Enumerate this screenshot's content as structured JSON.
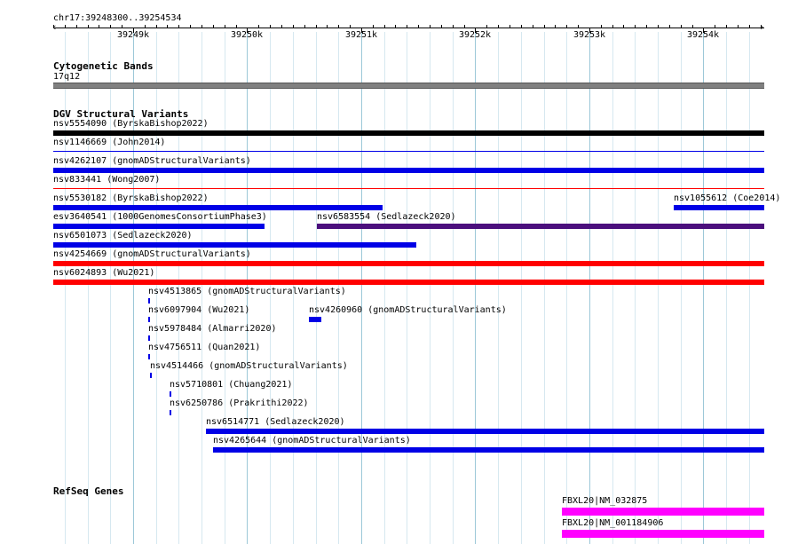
{
  "location": "chr17:39248300..39254534",
  "ruler": {
    "start": 39248300,
    "end": 39254534,
    "ticks": [
      "39249k",
      "39250k",
      "39251k",
      "39252k",
      "39253k",
      "39254k"
    ]
  },
  "colors": {
    "grid_major": "#9cc8d8",
    "grid_minor": "#d6e8f0",
    "separator": "#c83c3c",
    "band": "#808080",
    "black": "#000000",
    "blue": "#0000e6",
    "red": "#ff0000",
    "purple": "#4b0f7d",
    "magenta": "#ff00ff"
  },
  "tracks": {
    "cyto": {
      "title": "Cytogenetic Bands",
      "band_label": "17q12"
    },
    "dgv": {
      "title": "DGV Structural Variants"
    },
    "refseq": {
      "title": "RefSeq Genes"
    }
  },
  "dgv_features": [
    {
      "label": "nsv5554090 (ByrskaBishop2022)",
      "start": 39248300,
      "end": 39254534,
      "color": "black"
    },
    {
      "label": "nsv1146669 (John2014)",
      "start": 39248300,
      "end": 39254534,
      "color": "blue",
      "style": "thin"
    },
    {
      "label": "nsv4262107 (gnomADStructuralVariants)",
      "start": 39248300,
      "end": 39254534,
      "color": "blue"
    },
    {
      "label": "nsv833441 (Wong2007)",
      "start": 39248300,
      "end": 39254534,
      "color": "red",
      "style": "thin"
    },
    {
      "label": "nsv5530182 (ByrskaBishop2022)",
      "start": 39248300,
      "end": 39251190,
      "color": "blue"
    },
    {
      "label": "nsv1055612 (Coe2014)",
      "start": 39253740,
      "end": 39254534,
      "color": "blue"
    },
    {
      "label": "esv3640541 (1000GenomesConsortiumPhase3)",
      "start": 39248300,
      "end": 39250150,
      "color": "blue"
    },
    {
      "label": "nsv6583554 (Sedlazeck2020)",
      "start": 39250610,
      "end": 39254534,
      "color": "purple"
    },
    {
      "label": "nsv6501073 (Sedlazeck2020)",
      "start": 39248300,
      "end": 39251480,
      "color": "blue"
    },
    {
      "label": "nsv4254669 (gnomADStructuralVariants)",
      "start": 39248300,
      "end": 39254534,
      "color": "red"
    },
    {
      "label": "nsv6024893 (Wu2021)",
      "start": 39248300,
      "end": 39254534,
      "color": "red"
    },
    {
      "label": "nsv4513865 (gnomADStructuralVariants)",
      "start": 39249130,
      "end": 39249145,
      "color": "blue"
    },
    {
      "label": "nsv6097904 (Wu2021)",
      "start": 39249130,
      "end": 39249145,
      "color": "blue"
    },
    {
      "label": "nsv4260960 (gnomADStructuralVariants)",
      "start": 39250540,
      "end": 39250650,
      "color": "blue"
    },
    {
      "label": "nsv5978484 (Almarri2020)",
      "start": 39249130,
      "end": 39249145,
      "color": "blue"
    },
    {
      "label": "nsv4756511 (Quan2021)",
      "start": 39249130,
      "end": 39249145,
      "color": "blue"
    },
    {
      "label": "nsv4514466 (gnomADStructuralVariants)",
      "start": 39249145,
      "end": 39249160,
      "color": "blue"
    },
    {
      "label": "nsv5710801 (Chuang2021)",
      "start": 39249320,
      "end": 39249335,
      "color": "blue"
    },
    {
      "label": "nsv6250786 (Prakrithi2022)",
      "start": 39249320,
      "end": 39249335,
      "color": "blue"
    },
    {
      "label": "nsv6514771 (Sedlazeck2020)",
      "start": 39249640,
      "end": 39254534,
      "color": "blue"
    },
    {
      "label": "nsv4265644 (gnomADStructuralVariants)",
      "start": 39249700,
      "end": 39254534,
      "color": "blue"
    }
  ],
  "refseq_features": [
    {
      "label": "FBXL20|NM_032875",
      "start": 39252760,
      "end": 39254534,
      "color": "magenta"
    },
    {
      "label": "FBXL20|NM_001184906",
      "start": 39252760,
      "end": 39254534,
      "color": "magenta"
    }
  ]
}
